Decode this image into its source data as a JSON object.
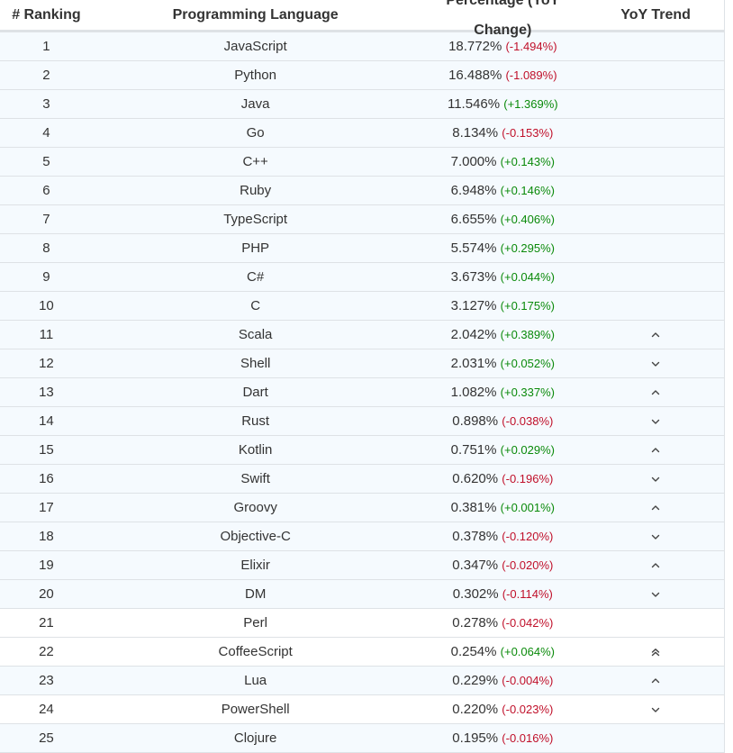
{
  "table": {
    "headers": {
      "ranking": "# Ranking",
      "language": "Programming Language",
      "percentage": "Percentage (YoY Change)",
      "trend": "YoY Trend"
    },
    "colors": {
      "up": "#0a8a0a",
      "down": "#c0102a",
      "row_bg": "#f5fafe"
    },
    "rows": [
      {
        "rank": "1",
        "language": "JavaScript",
        "pct": "18.772%",
        "change": "(-1.494%)",
        "dir": "down",
        "trend": ""
      },
      {
        "rank": "2",
        "language": "Python",
        "pct": "16.488%",
        "change": "(-1.089%)",
        "dir": "down",
        "trend": ""
      },
      {
        "rank": "3",
        "language": "Java",
        "pct": "11.546%",
        "change": "(+1.369%)",
        "dir": "up",
        "trend": ""
      },
      {
        "rank": "4",
        "language": "Go",
        "pct": "8.134%",
        "change": "(-0.153%)",
        "dir": "down",
        "trend": ""
      },
      {
        "rank": "5",
        "language": "C++",
        "pct": "7.000%",
        "change": "(+0.143%)",
        "dir": "up",
        "trend": ""
      },
      {
        "rank": "6",
        "language": "Ruby",
        "pct": "6.948%",
        "change": "(+0.146%)",
        "dir": "up",
        "trend": ""
      },
      {
        "rank": "7",
        "language": "TypeScript",
        "pct": "6.655%",
        "change": "(+0.406%)",
        "dir": "up",
        "trend": ""
      },
      {
        "rank": "8",
        "language": "PHP",
        "pct": "5.574%",
        "change": "(+0.295%)",
        "dir": "up",
        "trend": ""
      },
      {
        "rank": "9",
        "language": "C#",
        "pct": "3.673%",
        "change": "(+0.044%)",
        "dir": "up",
        "trend": ""
      },
      {
        "rank": "10",
        "language": "C",
        "pct": "3.127%",
        "change": "(+0.175%)",
        "dir": "up",
        "trend": ""
      },
      {
        "rank": "11",
        "language": "Scala",
        "pct": "2.042%",
        "change": "(+0.389%)",
        "dir": "up",
        "trend": "chevron-up-icon"
      },
      {
        "rank": "12",
        "language": "Shell",
        "pct": "2.031%",
        "change": "(+0.052%)",
        "dir": "up",
        "trend": "chevron-down-icon"
      },
      {
        "rank": "13",
        "language": "Dart",
        "pct": "1.082%",
        "change": "(+0.337%)",
        "dir": "up",
        "trend": "chevron-up-icon"
      },
      {
        "rank": "14",
        "language": "Rust",
        "pct": "0.898%",
        "change": "(-0.038%)",
        "dir": "down",
        "trend": "chevron-down-icon"
      },
      {
        "rank": "15",
        "language": "Kotlin",
        "pct": "0.751%",
        "change": "(+0.029%)",
        "dir": "up",
        "trend": "chevron-up-icon"
      },
      {
        "rank": "16",
        "language": "Swift",
        "pct": "0.620%",
        "change": "(-0.196%)",
        "dir": "down",
        "trend": "chevron-down-icon"
      },
      {
        "rank": "17",
        "language": "Groovy",
        "pct": "0.381%",
        "change": "(+0.001%)",
        "dir": "up",
        "trend": "chevron-up-icon"
      },
      {
        "rank": "18",
        "language": "Objective-C",
        "pct": "0.378%",
        "change": "(-0.120%)",
        "dir": "down",
        "trend": "chevron-down-icon"
      },
      {
        "rank": "19",
        "language": "Elixir",
        "pct": "0.347%",
        "change": "(-0.020%)",
        "dir": "down",
        "trend": "chevron-up-icon"
      },
      {
        "rank": "20",
        "language": "DM",
        "pct": "0.302%",
        "change": "(-0.114%)",
        "dir": "down",
        "trend": "chevron-down-icon"
      },
      {
        "rank": "21",
        "language": "Perl",
        "pct": "0.278%",
        "change": "(-0.042%)",
        "dir": "down",
        "trend": ""
      },
      {
        "rank": "22",
        "language": "CoffeeScript",
        "pct": "0.254%",
        "change": "(+0.064%)",
        "dir": "up",
        "trend": "double-chevron-up-icon"
      },
      {
        "rank": "23",
        "language": "Lua",
        "pct": "0.229%",
        "change": "(-0.004%)",
        "dir": "down",
        "trend": "chevron-up-icon"
      },
      {
        "rank": "24",
        "language": "PowerShell",
        "pct": "0.220%",
        "change": "(-0.023%)",
        "dir": "down",
        "trend": "chevron-down-icon"
      },
      {
        "rank": "25",
        "language": "Clojure",
        "pct": "0.195%",
        "change": "(-0.016%)",
        "dir": "down",
        "trend": ""
      }
    ]
  }
}
